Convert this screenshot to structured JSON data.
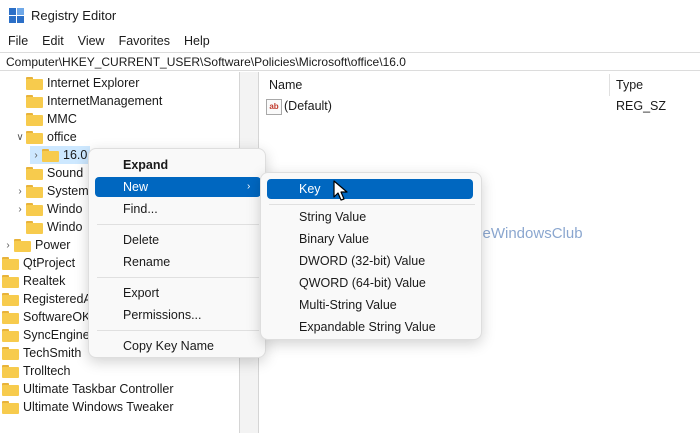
{
  "window": {
    "title": "Registry Editor"
  },
  "menubar": {
    "items": [
      "File",
      "Edit",
      "View",
      "Favorites",
      "Help"
    ]
  },
  "address": {
    "path": "Computer\\HKEY_CURRENT_USER\\Software\\Policies\\Microsoft\\office\\16.0"
  },
  "tree": {
    "items": [
      {
        "label": "Internet Explorer",
        "expander": ""
      },
      {
        "label": "InternetManagement",
        "expander": ""
      },
      {
        "label": "MMC",
        "expander": ""
      },
      {
        "label": "office",
        "expander": "expanded"
      },
      {
        "label": "16.0",
        "expander": "collapsed"
      },
      {
        "label": "Sound",
        "expander": ""
      },
      {
        "label": "System",
        "expander": "collapsed"
      },
      {
        "label": "Windo",
        "expander": "collapsed"
      },
      {
        "label": "Windo",
        "expander": ""
      },
      {
        "label": "Power",
        "expander": "collapsed"
      },
      {
        "label": "QtProject",
        "expander": "collapsed"
      },
      {
        "label": "Realtek",
        "expander": ""
      },
      {
        "label": "RegisteredAp",
        "expander": ""
      },
      {
        "label": "SoftwareOK",
        "expander": ""
      },
      {
        "label": "SyncEngines",
        "expander": ""
      },
      {
        "label": "TechSmith",
        "expander": ""
      },
      {
        "label": "Trolltech",
        "expander": ""
      },
      {
        "label": "Ultimate Taskbar Controller",
        "expander": ""
      },
      {
        "label": "Ultimate Windows Tweaker",
        "expander": ""
      }
    ]
  },
  "list": {
    "columns": {
      "name": "Name",
      "type": "Type"
    },
    "rows": [
      {
        "icon": "ab",
        "name": "(Default)",
        "type": "REG_SZ"
      }
    ]
  },
  "context_menu": {
    "items": [
      "Expand",
      "New",
      "Find...",
      "Delete",
      "Rename",
      "Export",
      "Permissions...",
      "Copy Key Name"
    ],
    "highlighted": "New"
  },
  "submenu": {
    "items": [
      "Key",
      "String Value",
      "Binary Value",
      "DWORD (32-bit) Value",
      "QWORD (64-bit) Value",
      "Multi-String Value",
      "Expandable String Value"
    ],
    "highlighted": "Key"
  },
  "watermark": {
    "text": "TheWindowsClub"
  },
  "colors": {
    "accent": "#0067c0",
    "folder": "#f7cb4d",
    "selection": "#cde8ff"
  }
}
